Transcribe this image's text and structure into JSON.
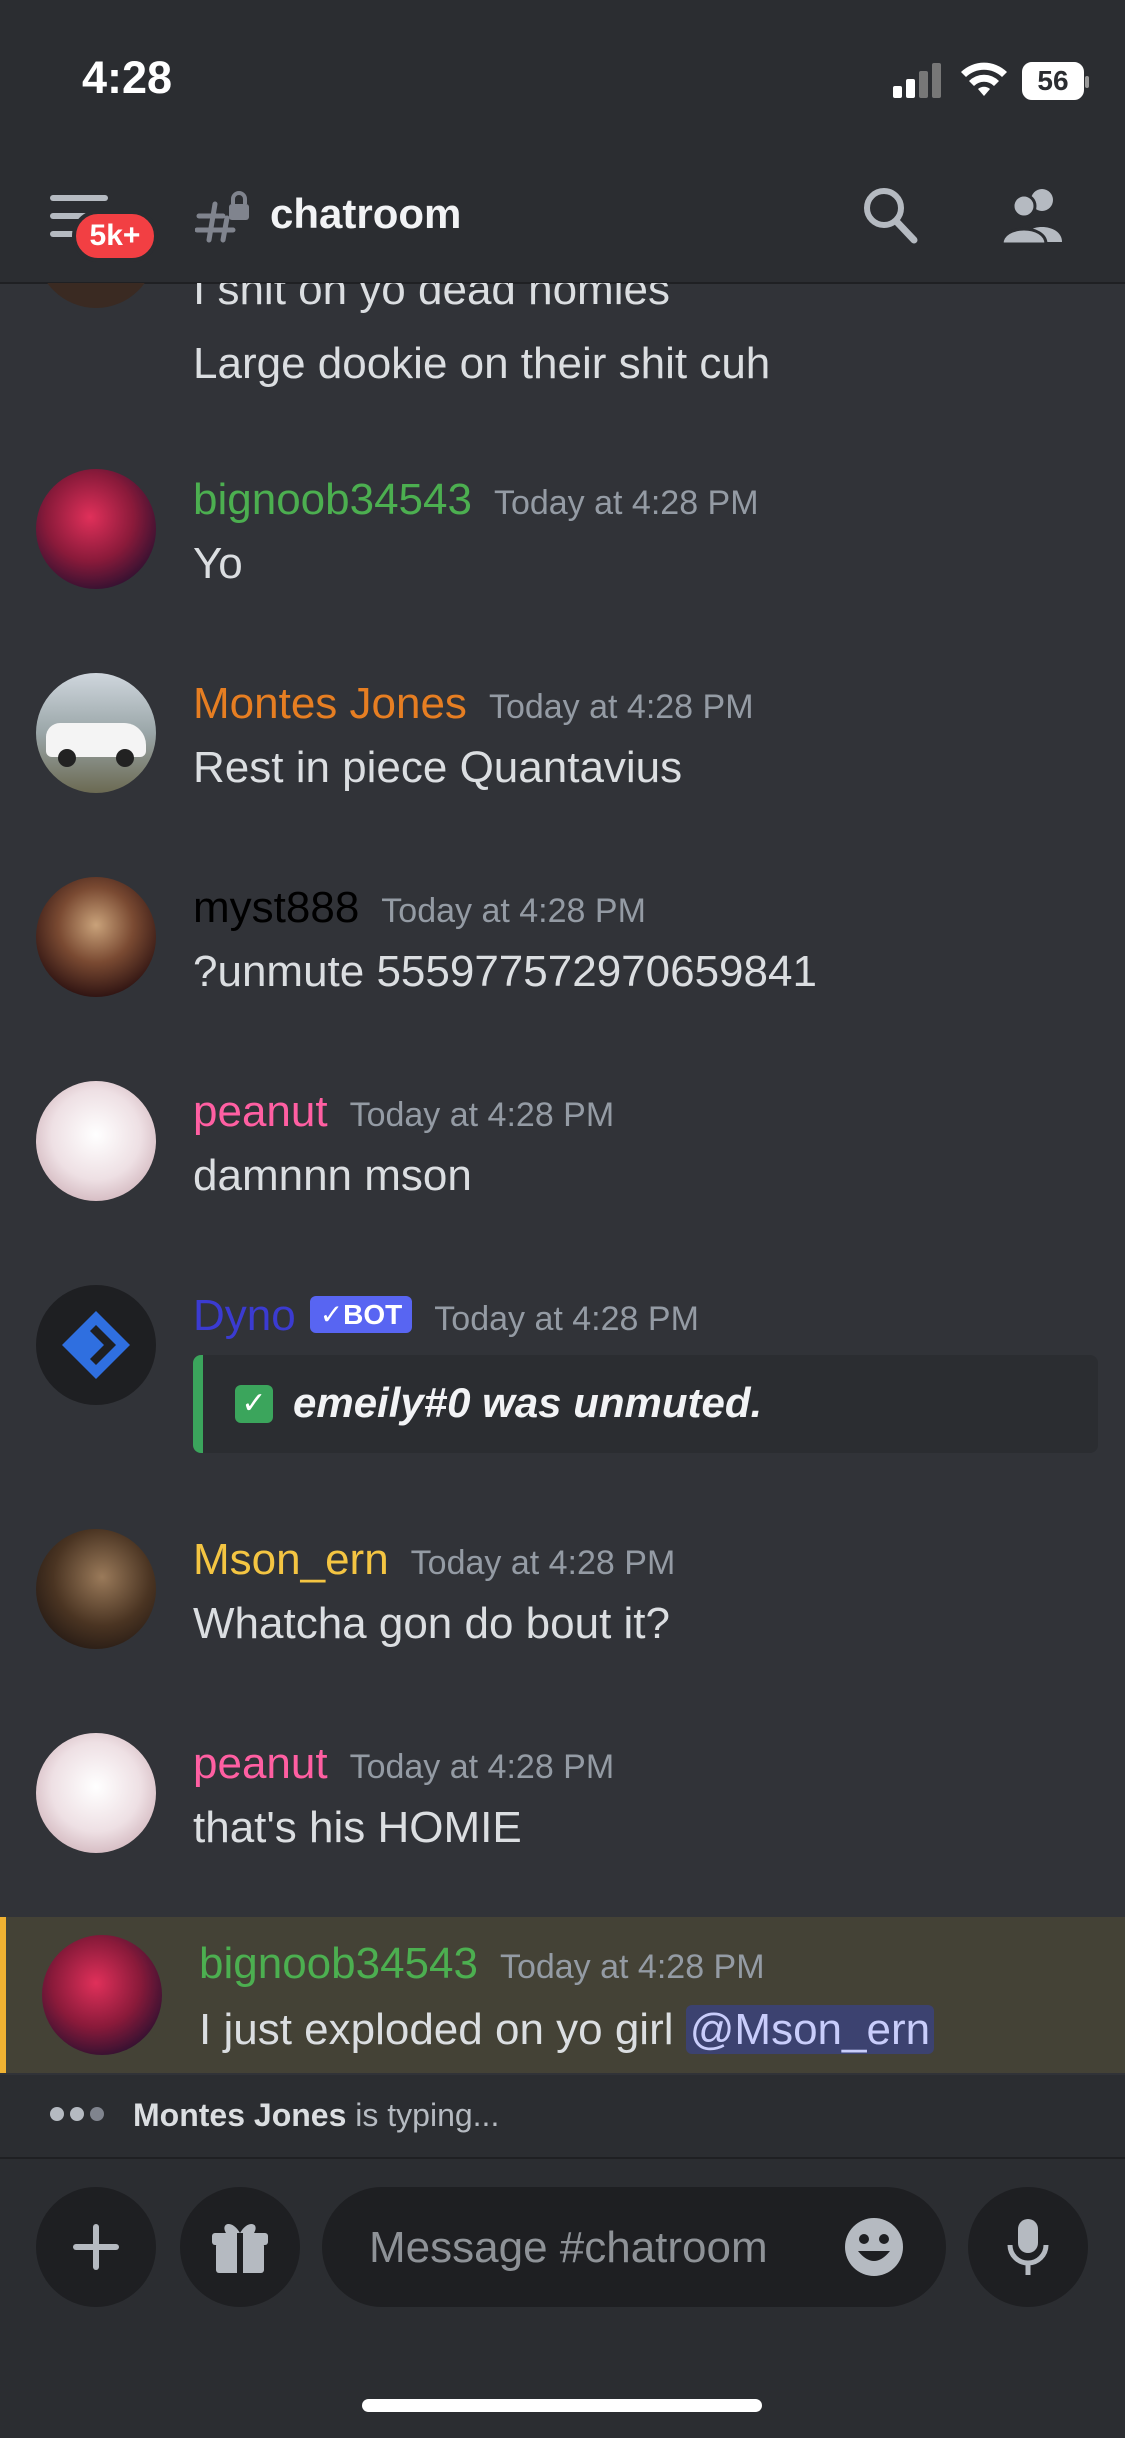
{
  "status_bar": {
    "time": "4:28",
    "battery": "56"
  },
  "header": {
    "unread_badge": "5k+",
    "channel_name": "chatroom"
  },
  "messages": [
    {
      "continuation": [
        "I shit on yo dead homies",
        "Large dookie on their shit cuh"
      ]
    },
    {
      "author": "bignoob34543",
      "author_color": "#4caf50",
      "timestamp": "Today at 4:28 PM",
      "text": "Yo"
    },
    {
      "author": "Montes Jones",
      "author_color": "#e67e22",
      "timestamp": "Today at 4:28 PM",
      "text": "Rest in piece Quantavius"
    },
    {
      "author": "myst888",
      "author_color": "#000000",
      "timestamp": "Today at 4:28 PM",
      "text": "?unmute 555977572970659841"
    },
    {
      "author": "peanut",
      "author_color": "#ff5fa2",
      "timestamp": "Today at 4:28 PM",
      "text": "damnnn mson"
    },
    {
      "author": "Dyno",
      "author_color": "#3b3bd1",
      "bot_tag": "✓BOT",
      "timestamp": "Today at 4:28 PM",
      "embed_text": "emeily#0 was unmuted."
    },
    {
      "author": "Mson_ern",
      "author_color": "#f4c542",
      "timestamp": "Today at 4:28 PM",
      "text": "Whatcha gon do bout it?"
    },
    {
      "author": "peanut",
      "author_color": "#ff5fa2",
      "timestamp": "Today at 4:28 PM",
      "text": "that's his HOMIE"
    },
    {
      "author": "bignoob34543",
      "author_color": "#4caf50",
      "timestamp": "Today at 4:28 PM",
      "text": "I just exploded on yo girl",
      "mention": "@Mson_ern"
    }
  ],
  "typing": {
    "user": "Montes Jones",
    "suffix": "is typing..."
  },
  "composer": {
    "placeholder": "Message #chatroom"
  },
  "colors": {
    "background": "#313338",
    "surface": "#2b2d31",
    "accent": "#5865f2",
    "highlight_bar": "#f0b232"
  }
}
